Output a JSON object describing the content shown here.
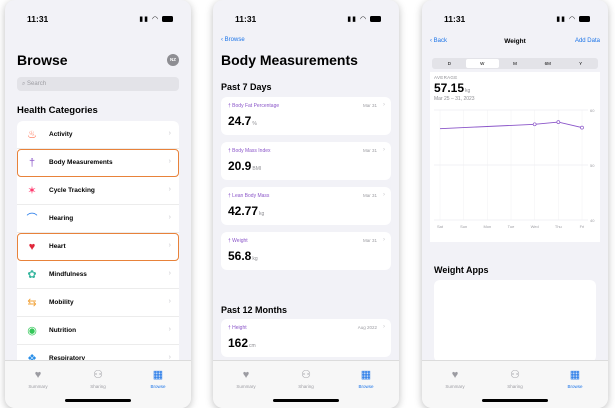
{
  "status": {
    "time": "11:31"
  },
  "tabs": [
    {
      "label": "Summary",
      "icon": "heart-icon"
    },
    {
      "label": "Sharing",
      "icon": "people-icon"
    },
    {
      "label": "Browse",
      "icon": "grid-icon"
    }
  ],
  "screen1": {
    "title": "Browse",
    "avatar": "NZ",
    "search_placeholder": "Search",
    "section": "Health Categories",
    "categories": [
      {
        "label": "Activity",
        "icon": "flame-icon",
        "color": "#ff5e3a",
        "highlighted": false
      },
      {
        "label": "Body Measurements",
        "icon": "figure-icon",
        "color": "#8b56c9",
        "highlighted": true
      },
      {
        "label": "Cycle Tracking",
        "icon": "cycle-icon",
        "color": "#ff3b6f",
        "highlighted": false
      },
      {
        "label": "Hearing",
        "icon": "ear-icon",
        "color": "#1a73e8",
        "highlighted": false
      },
      {
        "label": "Heart",
        "icon": "heart-icon",
        "color": "#e0263a",
        "highlighted": true
      },
      {
        "label": "Mindfulness",
        "icon": "flower-icon",
        "color": "#3ab7a0",
        "highlighted": false
      },
      {
        "label": "Mobility",
        "icon": "arrows-icon",
        "color": "#f2a33a",
        "highlighted": false
      },
      {
        "label": "Nutrition",
        "icon": "apple-icon",
        "color": "#34c759",
        "highlighted": false
      },
      {
        "label": "Respiratory",
        "icon": "lungs-icon",
        "color": "#2a8fe8",
        "highlighted": false
      }
    ]
  },
  "screen2": {
    "back": "Browse",
    "title": "Body Measurements",
    "section_recent": "Past 7 Days",
    "section_older": "Past 12 Months",
    "measurements": [
      {
        "label": "Body Fat Percentage",
        "date": "Mar 31",
        "value": "24.7",
        "unit": "%"
      },
      {
        "label": "Body Mass Index",
        "date": "Mar 31",
        "value": "20.9",
        "unit": "BMI"
      },
      {
        "label": "Lean Body Mass",
        "date": "Mar 31",
        "value": "42.77",
        "unit": "kg"
      },
      {
        "label": "Weight",
        "date": "Mar 31",
        "value": "56.8",
        "unit": "kg"
      }
    ],
    "older": [
      {
        "label": "Height",
        "date": "Aug 2022",
        "value": "162",
        "unit": "cm"
      }
    ]
  },
  "screen3": {
    "back": "Back",
    "title": "Weight",
    "add": "Add Data",
    "segments": [
      "D",
      "W",
      "M",
      "6M",
      "Y"
    ],
    "selected_segment": "W",
    "average_label": "AVERAGE",
    "average_value": "57.15",
    "average_unit": "kg",
    "range": "Mar 25 – 31, 2023",
    "apps_title": "Weight Apps"
  },
  "chart_data": {
    "type": "line",
    "categories": [
      "Sat",
      "Sun",
      "Mon",
      "Tue",
      "Wed",
      "Thu",
      "Fri"
    ],
    "values": [
      56.6,
      56.8,
      57.0,
      57.2,
      57.4,
      57.8,
      56.8
    ],
    "yticks": [
      "60",
      "50",
      "40"
    ],
    "ylim": [
      40,
      60
    ],
    "grid": true,
    "color": "#8b56c9"
  }
}
